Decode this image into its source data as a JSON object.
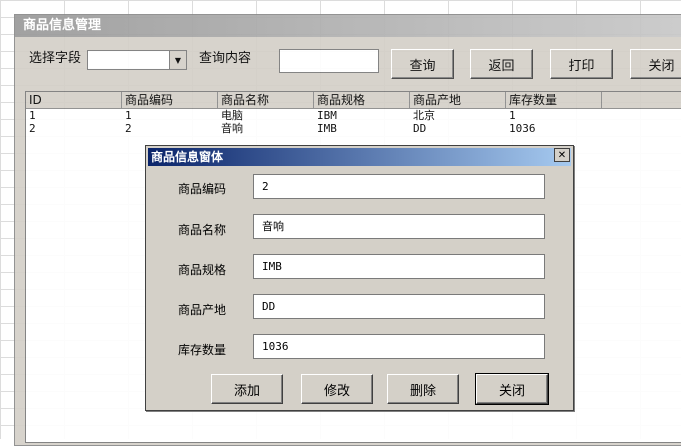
{
  "main": {
    "title": "商品信息管理",
    "search": {
      "field_label": "选择字段",
      "field_value": "",
      "content_label": "查询内容",
      "content_value": ""
    },
    "buttons": {
      "query": "查询",
      "back": "返回",
      "print": "打印",
      "close": "关闭"
    },
    "table": {
      "headers": [
        "ID",
        "商品编码",
        "商品名称",
        "商品规格",
        "商品产地",
        "库存数量"
      ],
      "rows": [
        [
          "1",
          "1",
          "电脑",
          "IBM",
          "北京",
          "1"
        ],
        [
          "2",
          "2",
          "音响",
          "IMB",
          "DD",
          "1036"
        ]
      ]
    }
  },
  "dialog": {
    "title": "商品信息窗体",
    "close_glyph": "✕",
    "fields": [
      {
        "label": "商品编码",
        "value": "2"
      },
      {
        "label": "商品名称",
        "value": "音响"
      },
      {
        "label": "商品规格",
        "value": "IMB"
      },
      {
        "label": "商品产地",
        "value": "DD"
      },
      {
        "label": "库存数量",
        "value": "1036"
      }
    ],
    "buttons": {
      "add": "添加",
      "edit": "修改",
      "delete": "删除",
      "close": "关闭"
    }
  },
  "icons": {
    "dropdown_arrow": "▼"
  }
}
